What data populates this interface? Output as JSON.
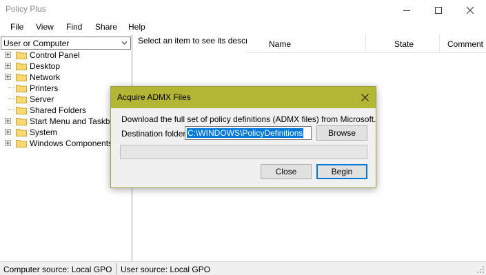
{
  "window": {
    "title": "Policy Plus",
    "controls": [
      "minimize-icon",
      "maximize-icon",
      "close-icon"
    ]
  },
  "menu": {
    "items": [
      "File",
      "View",
      "Find",
      "Share",
      "Help"
    ]
  },
  "scope": {
    "selected": "User or Computer"
  },
  "tree": {
    "items": [
      {
        "label": "Control Panel",
        "expandable": true,
        "icon": "folder-icon"
      },
      {
        "label": "Desktop",
        "expandable": true,
        "icon": "folder-icon"
      },
      {
        "label": "Network",
        "expandable": true,
        "icon": "folder-icon"
      },
      {
        "label": "Printers",
        "expandable": false,
        "icon": "folder-icon"
      },
      {
        "label": "Server",
        "expandable": false,
        "icon": "folder-icon"
      },
      {
        "label": "Shared Folders",
        "expandable": false,
        "icon": "folder-icon"
      },
      {
        "label": "Start Menu and Taskbar",
        "expandable": true,
        "icon": "folder-icon"
      },
      {
        "label": "System",
        "expandable": true,
        "icon": "folder-icon"
      },
      {
        "label": "Windows Components",
        "expandable": true,
        "icon": "folder-icon"
      }
    ]
  },
  "description": {
    "text": "Select an item to see its description."
  },
  "list": {
    "columns": [
      "Name",
      "State",
      "Comment"
    ]
  },
  "status": {
    "computer_source": "Computer source:  Local GPO",
    "user_source": "User source:  Local GPO"
  },
  "dialog": {
    "title": "Acquire ADMX Files",
    "message": "Download the full set of policy definitions (ADMX files) from Microsoft.",
    "dest_label": "Destination folder",
    "dest_value": "C:\\WINDOWS\\PolicyDefinitions",
    "browse_label": "Browse",
    "close_label": "Close",
    "begin_label": "Begin",
    "progress": 0,
    "accent_color": "#b3b534"
  }
}
